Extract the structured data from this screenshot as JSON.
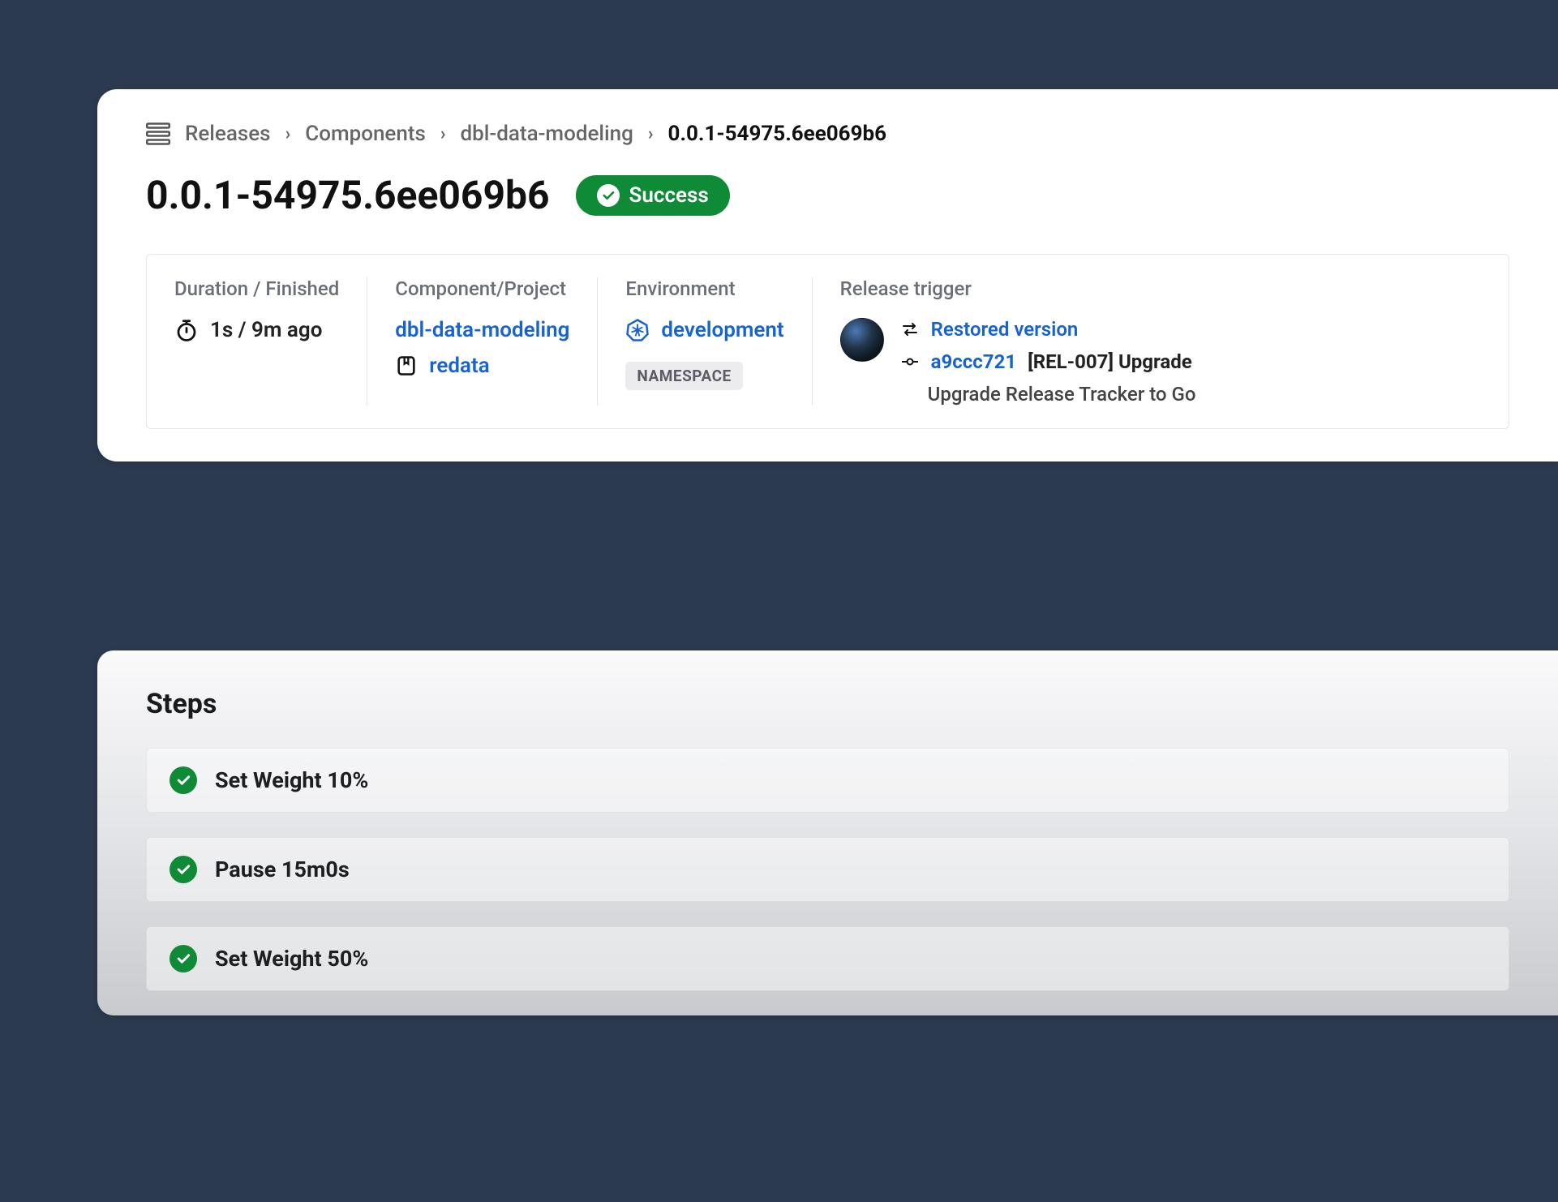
{
  "breadcrumbs": {
    "items": [
      {
        "label": "Releases"
      },
      {
        "label": "Components"
      },
      {
        "label": "dbl-data-modeling"
      },
      {
        "label": "0.0.1-54975.6ee069b6"
      }
    ]
  },
  "header": {
    "title": "0.0.1-54975.6ee069b6",
    "status_label": "Success",
    "status_color": "#0f8a36"
  },
  "meta": {
    "duration": {
      "label": "Duration / Finished",
      "value": "1s / 9m ago"
    },
    "component": {
      "label": "Component/Project",
      "component_link": "dbl-data-modeling",
      "project_link": "redata"
    },
    "environment": {
      "label": "Environment",
      "env_link": "development",
      "namespace_badge": "NAMESPACE"
    },
    "trigger": {
      "label": "Release trigger",
      "restored_label": "Restored version",
      "commit_hash": "a9ccc721",
      "commit_title": "[REL-007] Upgrade",
      "commit_subtitle": "Upgrade Release Tracker to Go"
    }
  },
  "steps": {
    "title": "Steps",
    "items": [
      {
        "label": "Set Weight 10%",
        "status": "success"
      },
      {
        "label": "Pause 15m0s",
        "status": "success"
      },
      {
        "label": "Set Weight 50%",
        "status": "success"
      }
    ]
  }
}
